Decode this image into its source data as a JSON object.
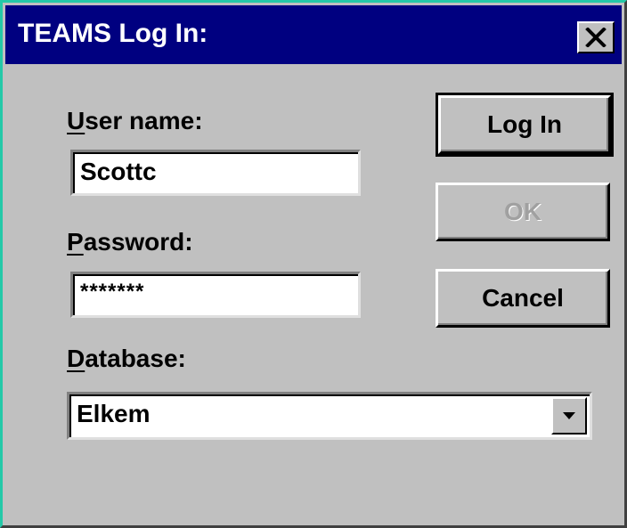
{
  "window": {
    "title": "TEAMS Log In:",
    "close_glyph": "✕"
  },
  "username": {
    "label_mnemonic": "U",
    "label_rest": "ser name:",
    "value": "Scottc"
  },
  "password": {
    "label_mnemonic": "P",
    "label_rest": "assword:",
    "value": "*******"
  },
  "database": {
    "label_mnemonic": "D",
    "label_rest": "atabase:",
    "value": "Elkem"
  },
  "buttons": {
    "login": "Log In",
    "ok": "OK",
    "cancel": "Cancel"
  },
  "colors": {
    "titlebar": "#000080",
    "face": "#c0c0c0",
    "window_edge": "#24c9a8"
  }
}
